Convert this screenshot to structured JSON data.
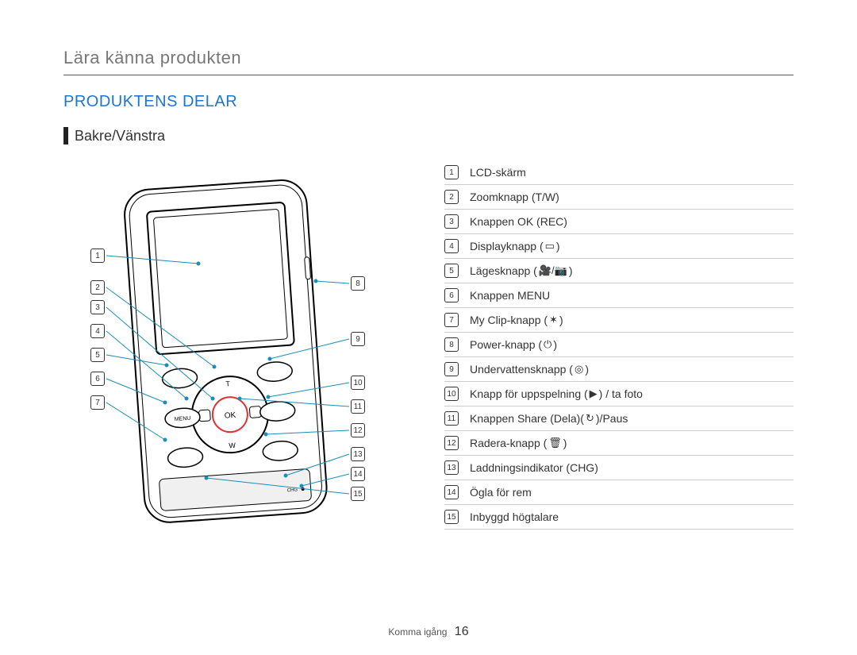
{
  "breadcrumb": "Lära känna produkten",
  "section_title": "PRODUKTENS DELAR",
  "subhead": "Bakre/Vänstra",
  "items": [
    {
      "n": "1",
      "label": "LCD-skärm"
    },
    {
      "n": "2",
      "label": "Zoomknapp (T/W)"
    },
    {
      "n": "3",
      "label": "Knappen OK (REC)"
    },
    {
      "n": "4",
      "label": "Displayknapp (",
      "icon": "display-icon",
      "suffix": ")"
    },
    {
      "n": "5",
      "label": "Lägesknapp (",
      "icon": "mode-icon",
      "suffix": ")"
    },
    {
      "n": "6",
      "label": "Knappen MENU"
    },
    {
      "n": "7",
      "label": "My Clip-knapp (",
      "icon": "clip-icon",
      "suffix": ")"
    },
    {
      "n": "8",
      "label": "Power-knapp (",
      "icon": "power-icon",
      "suffix": ")"
    },
    {
      "n": "9",
      "label": "Undervattensknapp (",
      "icon": "underwater-icon",
      "suffix": ")"
    },
    {
      "n": "10",
      "label": "Knapp för uppspelning (",
      "icon": "play-icon",
      "suffix": ") / ta foto"
    },
    {
      "n": "11",
      "label": "Knappen Share (Dela)(",
      "icon": "share-icon",
      "suffix": ")/Paus"
    },
    {
      "n": "12",
      "label": "Radera-knapp (",
      "icon": "trash-icon",
      "suffix": ")"
    },
    {
      "n": "13",
      "label": "Laddningsindikator (CHG)"
    },
    {
      "n": "14",
      "label": "Ögla för rem"
    },
    {
      "n": "15",
      "label": "Inbyggd högtalare"
    }
  ],
  "icons": {
    "display-icon": "▭",
    "mode-icon": "🎥/📷",
    "clip-icon": "✶",
    "power-icon": "⏻",
    "underwater-icon": "◎",
    "play-icon": "▶",
    "share-icon": "↻",
    "trash-icon": "🗑"
  },
  "diagram_left_callouts": [
    "1",
    "2",
    "3",
    "4",
    "5",
    "6",
    "7"
  ],
  "diagram_right_callouts": [
    "8",
    "9",
    "10",
    "11",
    "12",
    "13",
    "14",
    "15"
  ],
  "diagram_buttons": {
    "menu": "MENU",
    "ok": "OK",
    "chg": "CHG",
    "t": "T",
    "w": "W"
  },
  "footer": {
    "label": "Komma igång",
    "page": "16"
  }
}
